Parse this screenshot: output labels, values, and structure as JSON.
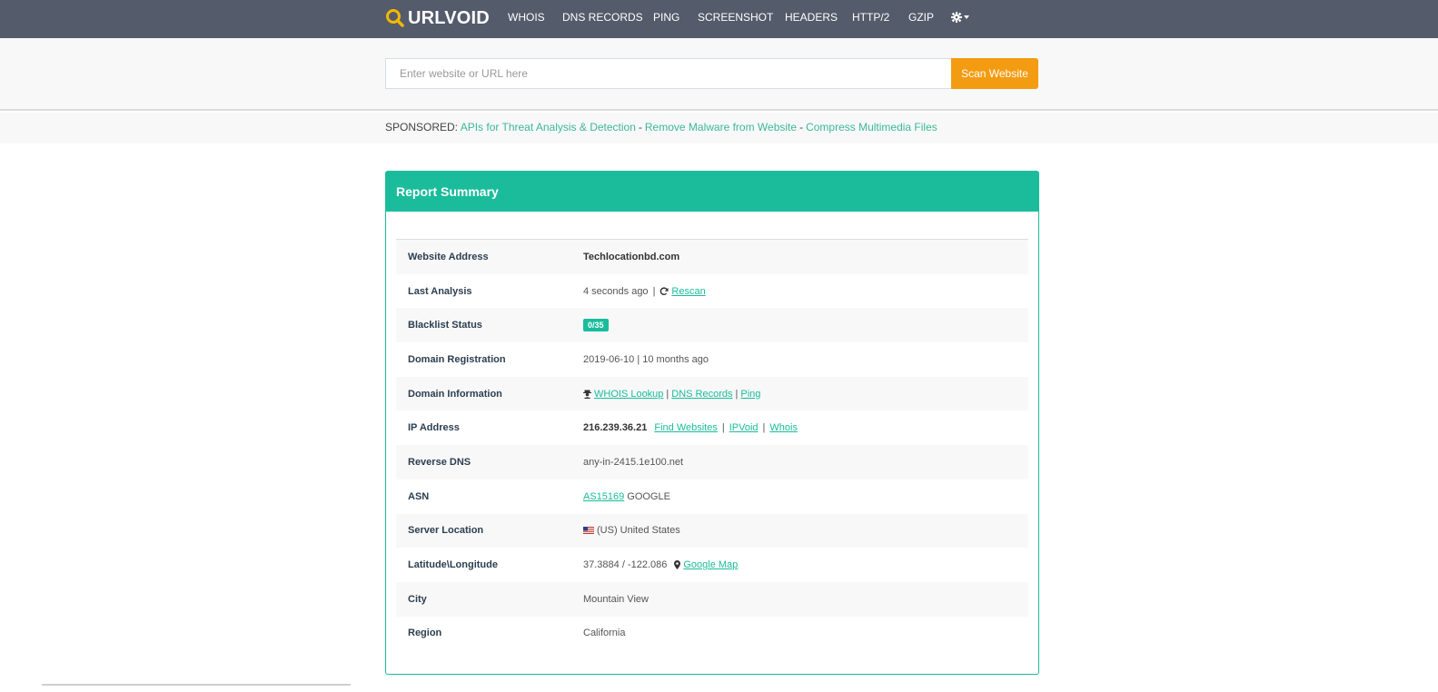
{
  "brand": {
    "name": "URLVOID"
  },
  "nav": {
    "items": [
      "WHOIS",
      "DNS RECORDS",
      "PING",
      "SCREENSHOT",
      "HEADERS",
      "HTTP/2",
      "GZIP"
    ],
    "settings_icon": "gear-icon"
  },
  "search": {
    "placeholder": "Enter website or URL here",
    "value": "",
    "button_label": "Scan Website"
  },
  "sponsored": {
    "label": "SPONSORED:",
    "links": [
      "APIs for Threat Analysis & Detection",
      "Remove Malware from Website",
      "Compress Multimedia Files"
    ],
    "separator": "-"
  },
  "report": {
    "title": "Report Summary",
    "rows": {
      "website_address": {
        "label": "Website Address",
        "value": "Techlocationbd.com"
      },
      "last_analysis": {
        "label": "Last Analysis",
        "value": "4 seconds ago",
        "sep": "|",
        "rescan": "Rescan"
      },
      "blacklist_status": {
        "label": "Blacklist Status",
        "badge": "0/35"
      },
      "domain_registration": {
        "label": "Domain Registration",
        "value": "2019-06-10 | 10 months ago"
      },
      "domain_information": {
        "label": "Domain Information",
        "whois": "WHOIS Lookup",
        "dns": "DNS Records",
        "ping": "Ping",
        "sep": "|"
      },
      "ip_address": {
        "label": "IP Address",
        "ip": "216.239.36.21",
        "find": "Find Websites",
        "ipvoid": "IPVoid",
        "whois": "Whois",
        "sep": "|"
      },
      "reverse_dns": {
        "label": "Reverse DNS",
        "value": "any-in-2415.1e100.net"
      },
      "asn": {
        "label": "ASN",
        "link": "AS15169",
        "name": "GOOGLE"
      },
      "server_location": {
        "label": "Server Location",
        "value": "(US) United States"
      },
      "lat_long": {
        "label": "Latitude\\Longitude",
        "value": "37.3884 / -122.086",
        "map": "Google Map"
      },
      "city": {
        "label": "City",
        "value": "Mountain View"
      },
      "region": {
        "label": "Region",
        "value": "California"
      }
    }
  },
  "colors": {
    "nav_bg": "#545b6b",
    "accent": "#1abc9c",
    "button": "#f39c12",
    "logo": "#f5b800"
  }
}
